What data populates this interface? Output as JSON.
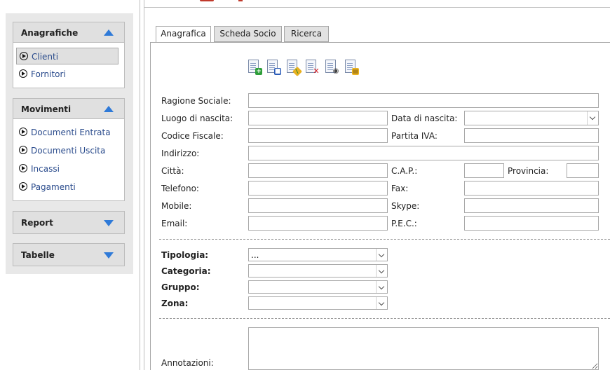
{
  "sidebar": {
    "panels": [
      {
        "title": "Anagrafiche",
        "expanded": true,
        "items": [
          "Clienti",
          "Fornitori"
        ],
        "active": "Clienti"
      },
      {
        "title": "Movimenti",
        "expanded": true,
        "items": [
          "Documenti Entrata",
          "Documenti Uscita",
          "Incassi",
          "Pagamenti"
        ]
      },
      {
        "title": "Report",
        "expanded": false,
        "items": []
      },
      {
        "title": "Tabelle",
        "expanded": false,
        "items": []
      }
    ]
  },
  "tabs": [
    "Anagrafica",
    "Scheda Socio",
    "Ricerca"
  ],
  "active_tab": "Anagrafica",
  "toolbar": [
    "new-document-icon",
    "save-document-icon",
    "edit-document-icon",
    "delete-document-icon",
    "view-document-icon",
    "print-document-icon"
  ],
  "form": {
    "ragione_sociale": "Ragione Sociale:",
    "luogo_nascita": "Luogo di nascita:",
    "data_nascita": "Data di nascita:",
    "codice_fiscale": "Codice Fiscale:",
    "partita_iva": "Partita IVA:",
    "indirizzo": "Indirizzo:",
    "citta": "Città:",
    "cap": "C.A.P.:",
    "provincia": "Provincia:",
    "telefono": "Telefono:",
    "fax": "Fax:",
    "mobile": "Mobile:",
    "skype": "Skype:",
    "email": "Email:",
    "pec": "P.E.C.:",
    "tipologia": "Tipologia:",
    "tipologia_value": "...",
    "categoria": "Categoria:",
    "gruppo": "Gruppo:",
    "zona": "Zona:",
    "annotazioni": "Annotazioni:"
  },
  "colors": {
    "accent_blue": "#2f7ad8",
    "link_text": "#2a4b8c",
    "header_bg": "#e0e0e0"
  }
}
